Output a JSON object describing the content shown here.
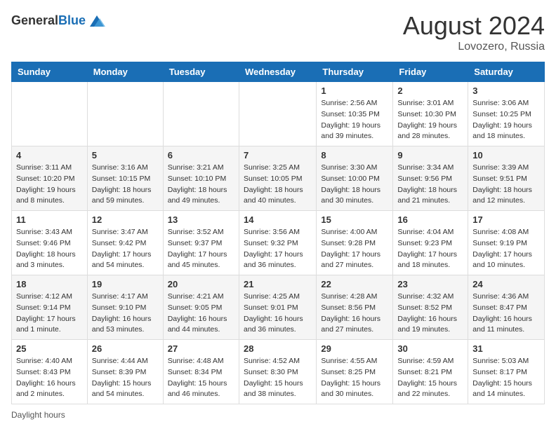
{
  "header": {
    "logo_general": "General",
    "logo_blue": "Blue",
    "month_year": "August 2024",
    "location": "Lovozero, Russia"
  },
  "days_of_week": [
    "Sunday",
    "Monday",
    "Tuesday",
    "Wednesday",
    "Thursday",
    "Friday",
    "Saturday"
  ],
  "weeks": [
    [
      {
        "day": "",
        "info": ""
      },
      {
        "day": "",
        "info": ""
      },
      {
        "day": "",
        "info": ""
      },
      {
        "day": "",
        "info": ""
      },
      {
        "day": "1",
        "info": "Sunrise: 2:56 AM\nSunset: 10:35 PM\nDaylight: 19 hours and 39 minutes."
      },
      {
        "day": "2",
        "info": "Sunrise: 3:01 AM\nSunset: 10:30 PM\nDaylight: 19 hours and 28 minutes."
      },
      {
        "day": "3",
        "info": "Sunrise: 3:06 AM\nSunset: 10:25 PM\nDaylight: 19 hours and 18 minutes."
      }
    ],
    [
      {
        "day": "4",
        "info": "Sunrise: 3:11 AM\nSunset: 10:20 PM\nDaylight: 19 hours and 8 minutes."
      },
      {
        "day": "5",
        "info": "Sunrise: 3:16 AM\nSunset: 10:15 PM\nDaylight: 18 hours and 59 minutes."
      },
      {
        "day": "6",
        "info": "Sunrise: 3:21 AM\nSunset: 10:10 PM\nDaylight: 18 hours and 49 minutes."
      },
      {
        "day": "7",
        "info": "Sunrise: 3:25 AM\nSunset: 10:05 PM\nDaylight: 18 hours and 40 minutes."
      },
      {
        "day": "8",
        "info": "Sunrise: 3:30 AM\nSunset: 10:00 PM\nDaylight: 18 hours and 30 minutes."
      },
      {
        "day": "9",
        "info": "Sunrise: 3:34 AM\nSunset: 9:56 PM\nDaylight: 18 hours and 21 minutes."
      },
      {
        "day": "10",
        "info": "Sunrise: 3:39 AM\nSunset: 9:51 PM\nDaylight: 18 hours and 12 minutes."
      }
    ],
    [
      {
        "day": "11",
        "info": "Sunrise: 3:43 AM\nSunset: 9:46 PM\nDaylight: 18 hours and 3 minutes."
      },
      {
        "day": "12",
        "info": "Sunrise: 3:47 AM\nSunset: 9:42 PM\nDaylight: 17 hours and 54 minutes."
      },
      {
        "day": "13",
        "info": "Sunrise: 3:52 AM\nSunset: 9:37 PM\nDaylight: 17 hours and 45 minutes."
      },
      {
        "day": "14",
        "info": "Sunrise: 3:56 AM\nSunset: 9:32 PM\nDaylight: 17 hours and 36 minutes."
      },
      {
        "day": "15",
        "info": "Sunrise: 4:00 AM\nSunset: 9:28 PM\nDaylight: 17 hours and 27 minutes."
      },
      {
        "day": "16",
        "info": "Sunrise: 4:04 AM\nSunset: 9:23 PM\nDaylight: 17 hours and 18 minutes."
      },
      {
        "day": "17",
        "info": "Sunrise: 4:08 AM\nSunset: 9:19 PM\nDaylight: 17 hours and 10 minutes."
      }
    ],
    [
      {
        "day": "18",
        "info": "Sunrise: 4:12 AM\nSunset: 9:14 PM\nDaylight: 17 hours and 1 minute."
      },
      {
        "day": "19",
        "info": "Sunrise: 4:17 AM\nSunset: 9:10 PM\nDaylight: 16 hours and 53 minutes."
      },
      {
        "day": "20",
        "info": "Sunrise: 4:21 AM\nSunset: 9:05 PM\nDaylight: 16 hours and 44 minutes."
      },
      {
        "day": "21",
        "info": "Sunrise: 4:25 AM\nSunset: 9:01 PM\nDaylight: 16 hours and 36 minutes."
      },
      {
        "day": "22",
        "info": "Sunrise: 4:28 AM\nSunset: 8:56 PM\nDaylight: 16 hours and 27 minutes."
      },
      {
        "day": "23",
        "info": "Sunrise: 4:32 AM\nSunset: 8:52 PM\nDaylight: 16 hours and 19 minutes."
      },
      {
        "day": "24",
        "info": "Sunrise: 4:36 AM\nSunset: 8:47 PM\nDaylight: 16 hours and 11 minutes."
      }
    ],
    [
      {
        "day": "25",
        "info": "Sunrise: 4:40 AM\nSunset: 8:43 PM\nDaylight: 16 hours and 2 minutes."
      },
      {
        "day": "26",
        "info": "Sunrise: 4:44 AM\nSunset: 8:39 PM\nDaylight: 15 hours and 54 minutes."
      },
      {
        "day": "27",
        "info": "Sunrise: 4:48 AM\nSunset: 8:34 PM\nDaylight: 15 hours and 46 minutes."
      },
      {
        "day": "28",
        "info": "Sunrise: 4:52 AM\nSunset: 8:30 PM\nDaylight: 15 hours and 38 minutes."
      },
      {
        "day": "29",
        "info": "Sunrise: 4:55 AM\nSunset: 8:25 PM\nDaylight: 15 hours and 30 minutes."
      },
      {
        "day": "30",
        "info": "Sunrise: 4:59 AM\nSunset: 8:21 PM\nDaylight: 15 hours and 22 minutes."
      },
      {
        "day": "31",
        "info": "Sunrise: 5:03 AM\nSunset: 8:17 PM\nDaylight: 15 hours and 14 minutes."
      }
    ]
  ],
  "footer": {
    "daylight_label": "Daylight hours"
  }
}
